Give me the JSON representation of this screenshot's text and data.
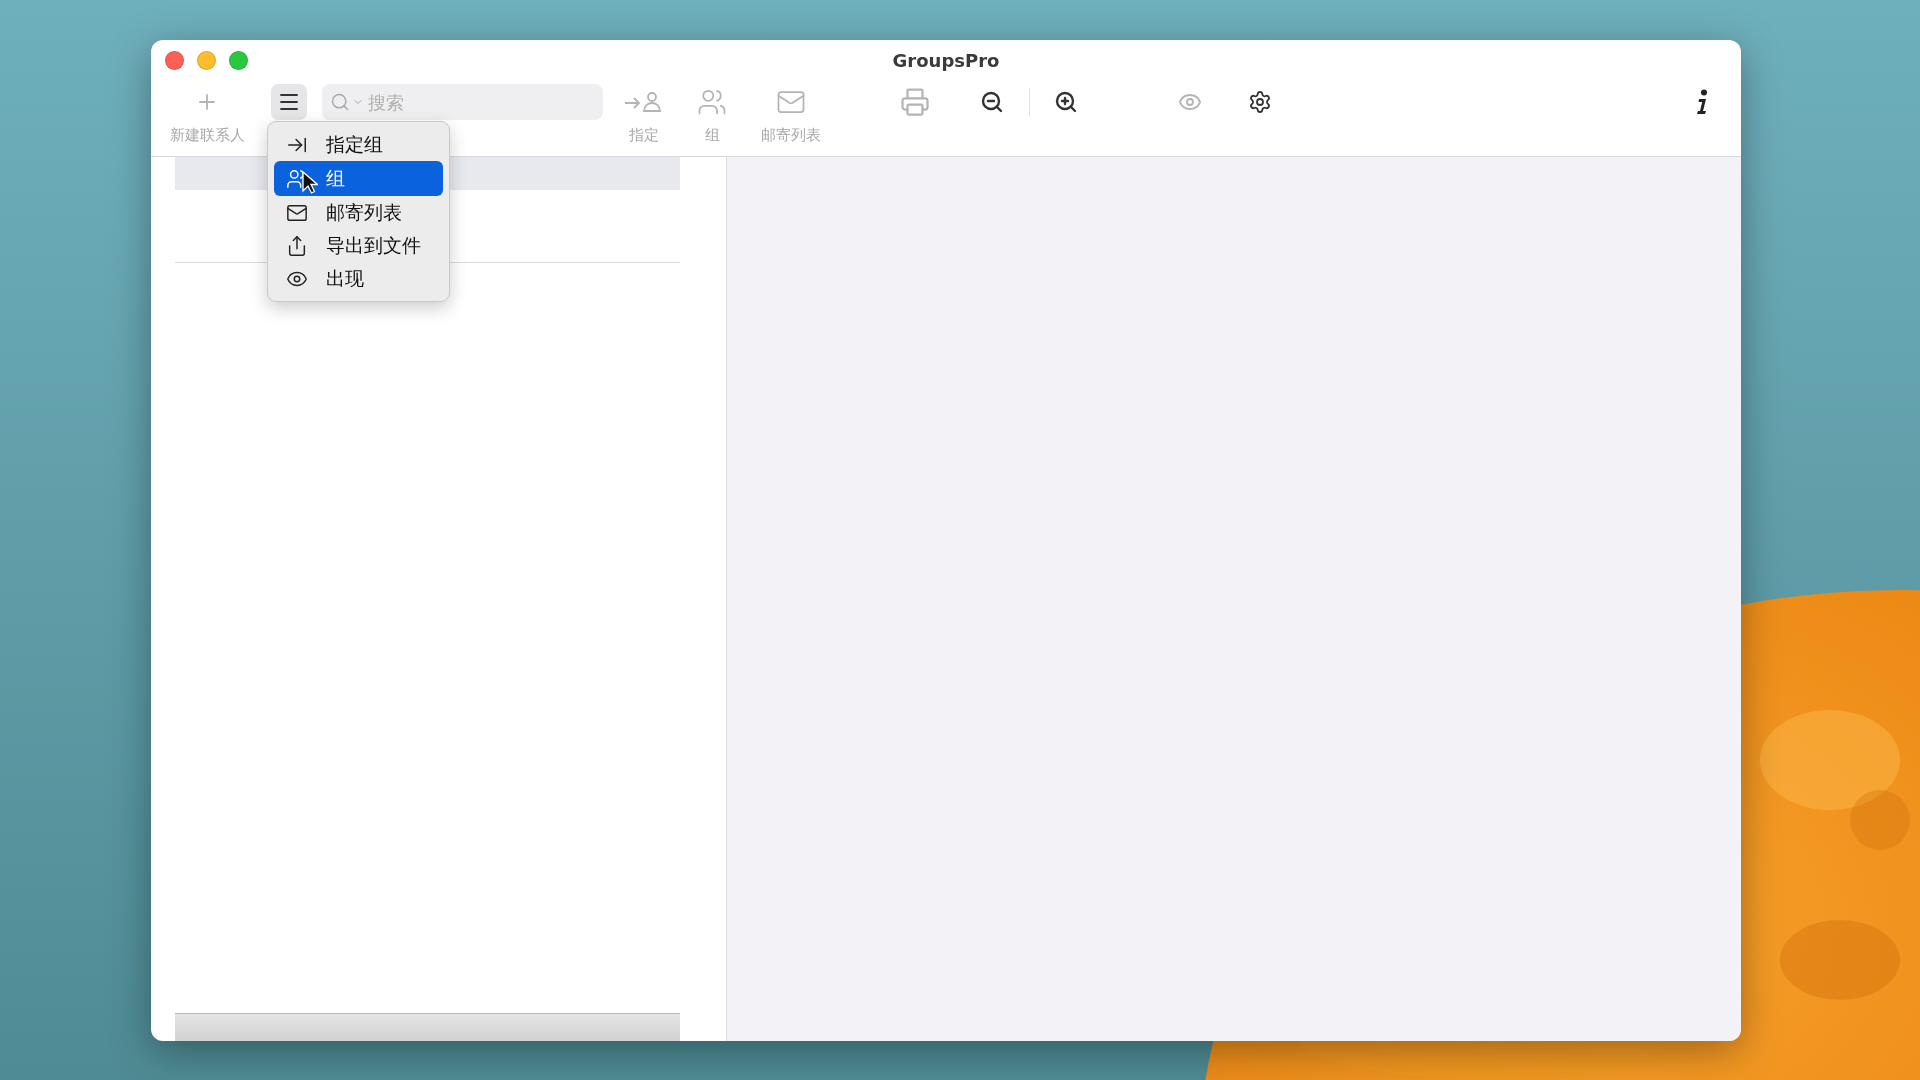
{
  "window": {
    "title": "GroupsPro"
  },
  "toolbar": {
    "new_contact": {
      "label": "新建联系人",
      "disabled": true
    },
    "menu_button": {
      "pressed": true
    },
    "search": {
      "placeholder": "搜索"
    },
    "assign": {
      "label": "指定",
      "disabled": true
    },
    "group": {
      "label": "组",
      "disabled": true
    },
    "mailing_list": {
      "label": "邮寄列表",
      "disabled": true
    },
    "print": {
      "disabled": true
    },
    "zoom_out": {
      "disabled": false
    },
    "zoom_in": {
      "disabled": false
    },
    "preview": {
      "disabled": true
    },
    "settings": {
      "disabled": false
    },
    "info": {
      "disabled": false
    }
  },
  "menu": {
    "items": [
      {
        "kind": "assign",
        "label": "指定组",
        "selected": false
      },
      {
        "kind": "group",
        "label": "组",
        "selected": true
      },
      {
        "kind": "mail",
        "label": "邮寄列表",
        "selected": false
      },
      {
        "kind": "export",
        "label": "导出到文件",
        "selected": false
      },
      {
        "kind": "appearance",
        "label": "出现",
        "selected": false
      }
    ]
  }
}
